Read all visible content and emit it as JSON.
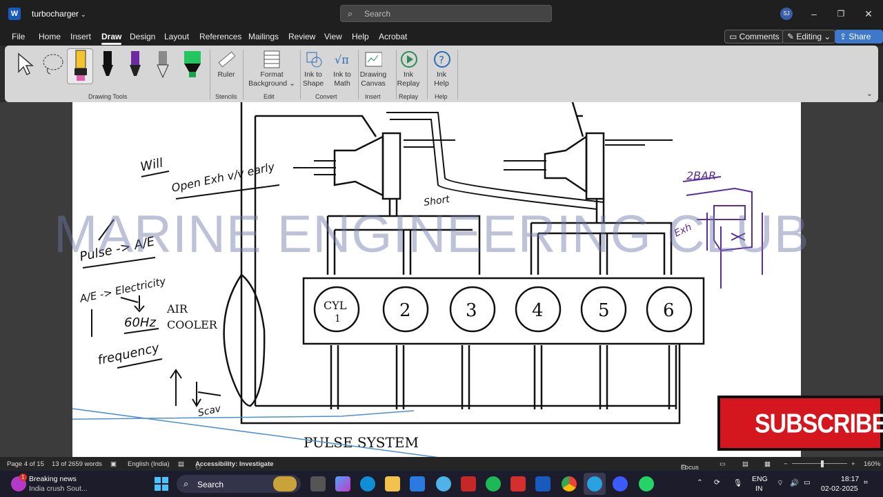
{
  "titlebar": {
    "app_icon": "W",
    "doc_title": "turbocharger",
    "search_placeholder": "Search",
    "avatar": "SJ"
  },
  "menu": {
    "tabs": [
      "File",
      "Home",
      "Insert",
      "Draw",
      "Design",
      "Layout",
      "References",
      "Mailings",
      "Review",
      "View",
      "Help",
      "Acrobat"
    ],
    "active_tab": "Draw",
    "comments_label": "Comments",
    "editing_label": "Editing",
    "share_label": "Share"
  },
  "ribbon": {
    "groups": {
      "drawing_tools": "Drawing Tools",
      "stencils": "Stencils",
      "edit": "Edit",
      "convert": "Convert",
      "insert": "Insert",
      "replay": "Replay",
      "help": "Help"
    },
    "ruler": "Ruler",
    "format_background_1": "Format",
    "format_background_2": "Background",
    "ink_to_shape_1": "Ink to",
    "ink_to_shape_2": "Shape",
    "ink_to_math_1": "Ink to",
    "ink_to_math_2": "Math",
    "drawing_canvas_1": "Drawing",
    "drawing_canvas_2": "Canvas",
    "ink_replay_1": "Ink",
    "ink_replay_2": "Replay",
    "ink_help_1": "Ink",
    "ink_help_2": "Help",
    "pen_colors": [
      "#f4c430",
      "#111111",
      "#6a2ca0",
      "#8a8a8a",
      "#22c55e"
    ]
  },
  "diagram": {
    "cylinders": [
      "CYL\n1",
      "2",
      "3",
      "4",
      "5",
      "6"
    ],
    "cyl_label": "CYL",
    "cyl_1": "1",
    "cyl_2": "2",
    "cyl_3": "3",
    "cyl_4": "4",
    "cyl_5": "5",
    "cyl_6": "6",
    "air_cooler_1": "AIR",
    "air_cooler_2": "COOLER",
    "pulse_system": "PULSE SYSTEM",
    "handwritten": {
      "will": "Will",
      "open_exh": "Open Exh v/v early",
      "short": "Short",
      "pulse_ae": "Pulse -> A/E",
      "ae_electricity": "A/E -> Electricity",
      "sixty_hz": "60Hz",
      "frequency": "frequency",
      "scavenge": "Scav",
      "two_bar": "2BAR",
      "exh": "Exh"
    }
  },
  "watermark": "MARINE ENGINEERING CLUB",
  "subscribe": "SUBSCRIBE",
  "statusbar": {
    "page": "Page 4 of 15",
    "words": "13 of 2659 words",
    "language": "English (India)",
    "accessibility": "Accessibility: Investigate",
    "focus": "Focus",
    "zoom": "160%"
  },
  "taskbar": {
    "news_title": "Breaking news",
    "news_sub": "India crush Sout...",
    "news_badge": "1",
    "search": "Search",
    "lang_1": "ENG",
    "lang_2": "IN",
    "time": "18:17",
    "date": "02-02-2025"
  }
}
